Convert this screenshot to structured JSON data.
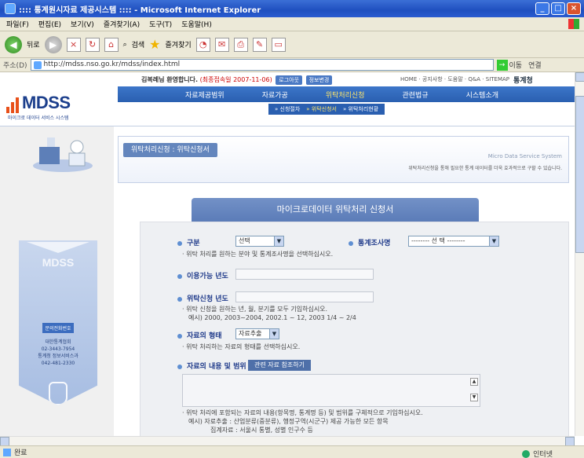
{
  "window": {
    "title": ":::: 통계원시자료 제공시스템 :::: - Microsoft Internet Explorer"
  },
  "menu": [
    "파일(F)",
    "편집(E)",
    "보기(V)",
    "즐겨찾기(A)",
    "도구(T)",
    "도움말(H)"
  ],
  "toolbar": {
    "back": "뒤로",
    "search": "검색",
    "favorites": "즐겨찾기"
  },
  "address": {
    "label": "주소(D)",
    "url": "http://mdss.nso.go.kr/mdss/index.html",
    "go": "이동",
    "links": "연결"
  },
  "status": {
    "left": "완료",
    "zone": "인터넷"
  },
  "site": {
    "welcome": "김복례님 환영합니다.",
    "last_login": "(최종접속일 2007-11-06)",
    "logout": "로그아웃",
    "edit_info": "정보변경",
    "toplinks": "HOME · 공지사항 · 도움말 · Q&A · SITEMAP",
    "stat_logo": "통계청",
    "logo_text": "MDSS",
    "logo_sub": "마이크로 데이터 서비스 시스템"
  },
  "nav": [
    "자료제공범위",
    "자료가공",
    "위탁처리신청",
    "관련법규",
    "시스템소개"
  ],
  "subnav": [
    "신청절차",
    "위탁신청서",
    "위탁처리현황"
  ],
  "sidebar": {
    "mdss": "MDSS",
    "contact": "문의전화번호",
    "info1": "대한통계협회",
    "info2": "02-3443-7954",
    "info3": "통계청 정보서비스과",
    "info4": "042-481-2330"
  },
  "banner": {
    "tab": "위탁처리신청 : 위탁신청서",
    "en": "Micro Data Service System",
    "desc": "위탁처리신청을 통해 필요한 통계 데이터를 더욱 효과적으로 구할 수 있습니다."
  },
  "form": {
    "title": "마이크로데이터 위탁처리 신청서",
    "division_label": "구분",
    "division_value": "선택",
    "survey_label": "통계조사명",
    "survey_value": "-------- 선 택 --------",
    "division_hint": "위탁 처리를 원하는 분야 및 통계조사명을 선택하십시오.",
    "year_label": "이용가능 년도",
    "req_year_label": "위탁신청 년도",
    "req_year_hint1": "위탁 신청을 원하는 년, 월, 분기를 모두 기입하십시오.",
    "req_year_hint2": "예시) 2000, 2003~2004, 2002.1 ~ 12, 2003 1/4 ~ 2/4",
    "type_label": "자료의 형태",
    "type_value": "자료추출",
    "type_hint": "위탁 처리하는 자료의 형태를 선택하십시오.",
    "content_label": "자료의 내용 및 범위",
    "ref_button": "관련 자료 참조하기",
    "content_hint1": "위탁 처리에 포함되는 자료의 내용(항목명, 통계명 등) 및 범위를 구체적으로 기입하십시오.",
    "content_hint2": "예시) 자료추출 : 산업분류(중분류), 행정구역(시군구) 제공 가능한 모든 항목",
    "content_hint3": "집계자료 : 서울시 통별, 성별 인구수 등"
  }
}
